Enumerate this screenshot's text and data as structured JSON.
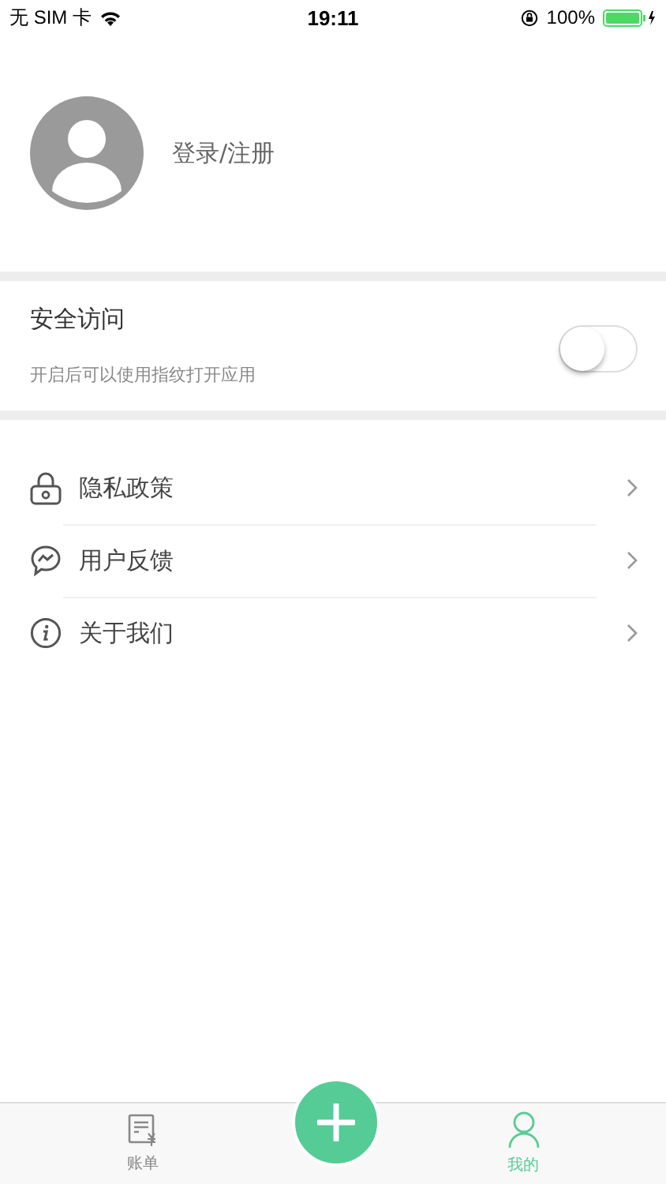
{
  "status_bar": {
    "carrier": "无 SIM 卡",
    "time": "19:11",
    "battery": "100%"
  },
  "profile": {
    "login": "登录/注册"
  },
  "security": {
    "title": "安全访问",
    "hint": "开启后可以使用指纹打开应用",
    "on": false
  },
  "menu": [
    {
      "label": "隐私政策"
    },
    {
      "label": "用户反馈"
    },
    {
      "label": "关于我们"
    }
  ],
  "tab_bar": [
    {
      "label": "账单",
      "selected": false
    },
    {
      "label": "我的",
      "selected": true
    }
  ]
}
